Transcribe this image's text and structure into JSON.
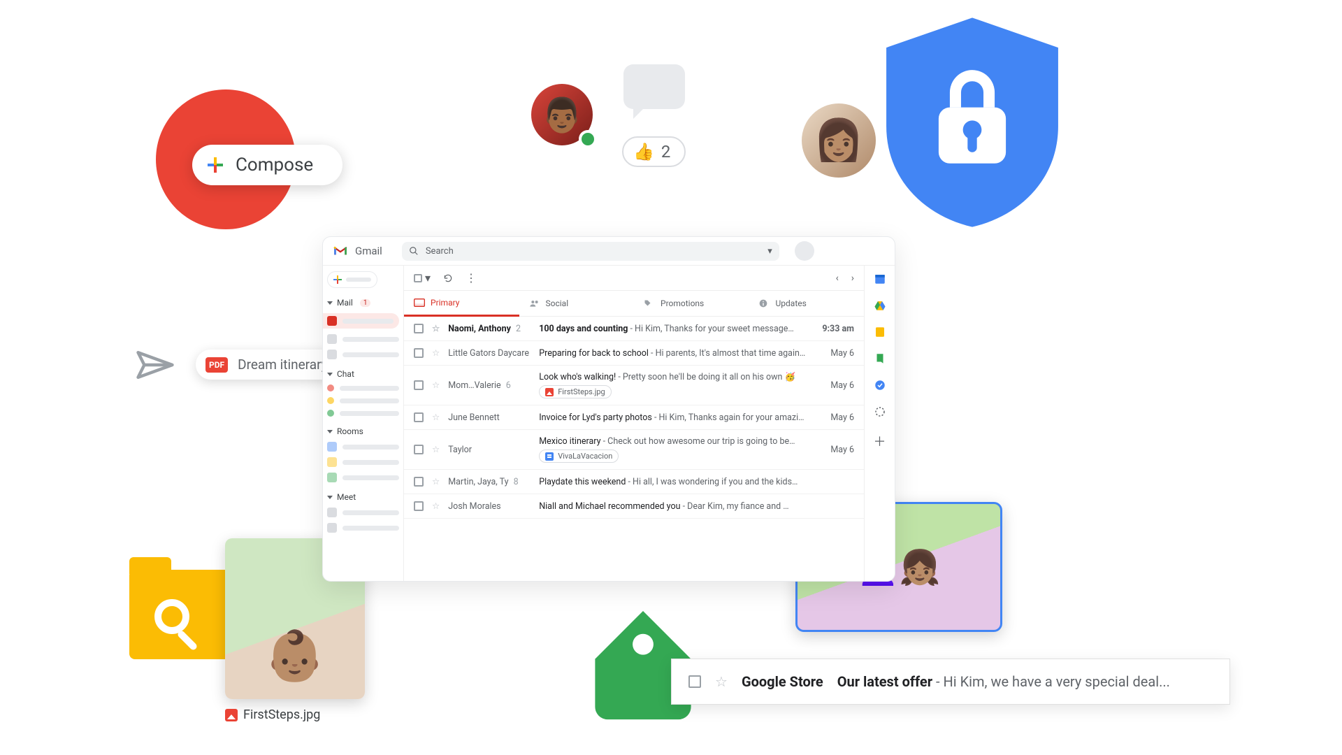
{
  "compose": {
    "label": "Compose"
  },
  "reaction": {
    "emoji": "👍",
    "count": "2"
  },
  "attach_pill": {
    "badge": "PDF",
    "title": "Dream itinerary"
  },
  "photo_caption": "FirstSteps.jpg",
  "promo": {
    "sender": "Google Store",
    "subject": "Our latest offer",
    "preview": " - Hi Kim, we have a very special deal..."
  },
  "gmail": {
    "brand": "Gmail",
    "search_placeholder": "Search",
    "nav": {
      "mail_label": "Mail",
      "mail_badge": "1",
      "chat_label": "Chat",
      "rooms_label": "Rooms",
      "meet_label": "Meet"
    },
    "tabs": {
      "primary": "Primary",
      "social": "Social",
      "promotions": "Promotions",
      "updates": "Updates"
    },
    "rows": [
      {
        "sender": "Naomi, Anthony",
        "count": "2",
        "subject": "100 days and counting",
        "preview": " - Hi Kim, Thanks for your sweet message…",
        "time": "9:33 am",
        "unread": true
      },
      {
        "sender": "Little Gators Daycare",
        "subject": "Preparing for back to school",
        "preview": " - Hi parents, It's almost that time again…",
        "time": "May 6"
      },
      {
        "sender": "Mom…Valerie",
        "count": "6",
        "subject": "Look who's walking!",
        "preview": " - Pretty soon he'll be doing it all on his own 🥳",
        "time": "May 6",
        "chip": {
          "type": "img",
          "label": "FirstSteps.jpg"
        }
      },
      {
        "sender": "June Bennett",
        "subject": "Invoice for Lyd's party photos",
        "preview": " - Hi Kim, Thanks again for your amazing…",
        "time": "May 6"
      },
      {
        "sender": "Taylor",
        "subject": "Mexico itinerary",
        "preview": " - Check out how awesome our trip is going to be…",
        "time": "May 6",
        "chip": {
          "type": "doc",
          "label": "VivaLaVacacion"
        }
      },
      {
        "sender": "Martin, Jaya, Ty",
        "count": "8",
        "subject": "Playdate this weekend",
        "preview": " - Hi all, I was wondering if you and the kids…",
        "time": ""
      },
      {
        "sender": "Josh Morales",
        "subject": "Niall and Michael recommended you",
        "preview": " - Dear Kim, my fiance and …",
        "time": ""
      }
    ]
  }
}
